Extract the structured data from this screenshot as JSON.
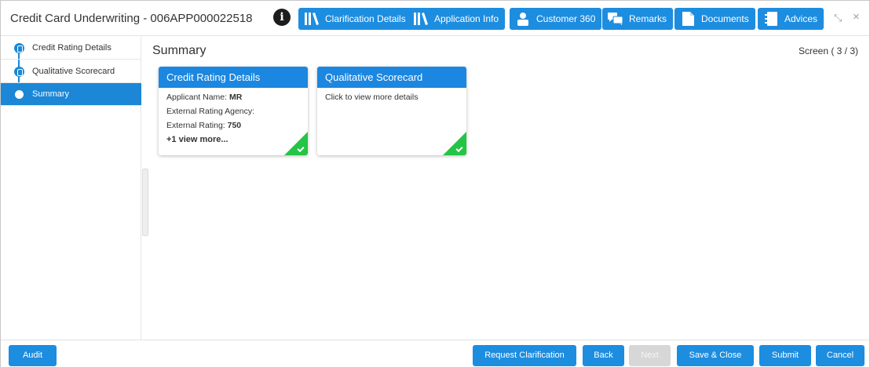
{
  "header": {
    "title": "Credit Card Underwriting - 006APP000022518",
    "buttons": [
      {
        "label": "Clarification Details",
        "icon": "books-icon"
      },
      {
        "label": "Application Info",
        "icon": "books-icon"
      },
      {
        "label": "Customer 360",
        "icon": "user-icon"
      },
      {
        "label": "Remarks",
        "icon": "chat-icon"
      },
      {
        "label": "Documents",
        "icon": "document-icon"
      },
      {
        "label": "Advices",
        "icon": "notebook-icon"
      }
    ],
    "info_glyph": "i",
    "minimize_glyph": "⤡",
    "close_glyph": "×"
  },
  "sidebar": {
    "items": [
      {
        "label": "Credit Rating Details"
      },
      {
        "label": "Qualitative Scorecard"
      },
      {
        "label": "Summary"
      }
    ]
  },
  "main": {
    "title": "Summary",
    "screen_indicator": "Screen ( 3 / 3)",
    "cards": [
      {
        "title": "Credit Rating Details",
        "lines": [
          {
            "label": "Applicant Name: ",
            "value": "MR"
          },
          {
            "label": "External Rating Agency:",
            "value": ""
          },
          {
            "label": "External Rating: ",
            "value": "750"
          }
        ],
        "more": "+1 view more..."
      },
      {
        "title": "Qualitative Scorecard",
        "lines": [
          {
            "label": "Click to view more details",
            "value": ""
          }
        ]
      }
    ]
  },
  "footer": {
    "audit": "Audit",
    "request_clarification": "Request Clarification",
    "back": "Back",
    "next": "Next",
    "save_close": "Save & Close",
    "submit": "Submit",
    "cancel": "Cancel"
  },
  "colors": {
    "primary": "#1d8de0",
    "success": "#24c445",
    "disabled": "#d7d7d7"
  }
}
